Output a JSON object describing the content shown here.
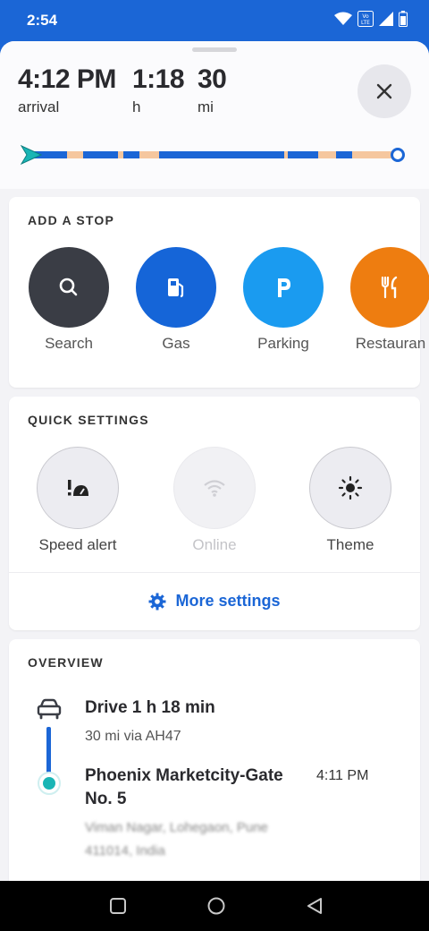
{
  "status": {
    "time": "2:54",
    "icons": [
      "wifi-icon",
      "volte-icon",
      "signal-icon",
      "battery-icon"
    ]
  },
  "trip": {
    "arrival_time": "4:12 PM",
    "arrival_label": "arrival",
    "duration_value": "1:18",
    "duration_unit": "h",
    "distance_value": "30",
    "distance_unit": "mi",
    "close_icon": "close-icon",
    "route_colors": {
      "main": "#1b66d6",
      "slow": "#f5c79e",
      "start": "#19b5b5"
    }
  },
  "add_stop": {
    "title": "ADD A STOP",
    "items": [
      {
        "label": "Search",
        "icon": "search-icon",
        "color": "#3a3d45"
      },
      {
        "label": "Gas",
        "icon": "gas-pump-icon",
        "color": "#1565d8"
      },
      {
        "label": "Parking",
        "icon": "parking-icon",
        "color": "#1a9bf0"
      },
      {
        "label": "Restauran",
        "icon": "fork-knife-icon",
        "color": "#ee7d10"
      }
    ]
  },
  "quick_settings": {
    "title": "QUICK SETTINGS",
    "items": [
      {
        "label": "Speed alert",
        "icon": "speed-alert-icon",
        "enabled": true
      },
      {
        "label": "Online",
        "icon": "wifi-icon",
        "enabled": false
      },
      {
        "label": "Theme",
        "icon": "sun-icon",
        "enabled": true
      }
    ],
    "more_settings": "More settings"
  },
  "overview": {
    "title": "OVERVIEW",
    "drive": "Drive 1 h 18 min",
    "via": "30 mi via AH47",
    "destination": "Phoenix Marketcity-Gate No. 5",
    "destination_time": "4:11 PM",
    "address_line1": "Viman Nagar, Lohegaon, Pune",
    "address_line2": "411014, India"
  }
}
